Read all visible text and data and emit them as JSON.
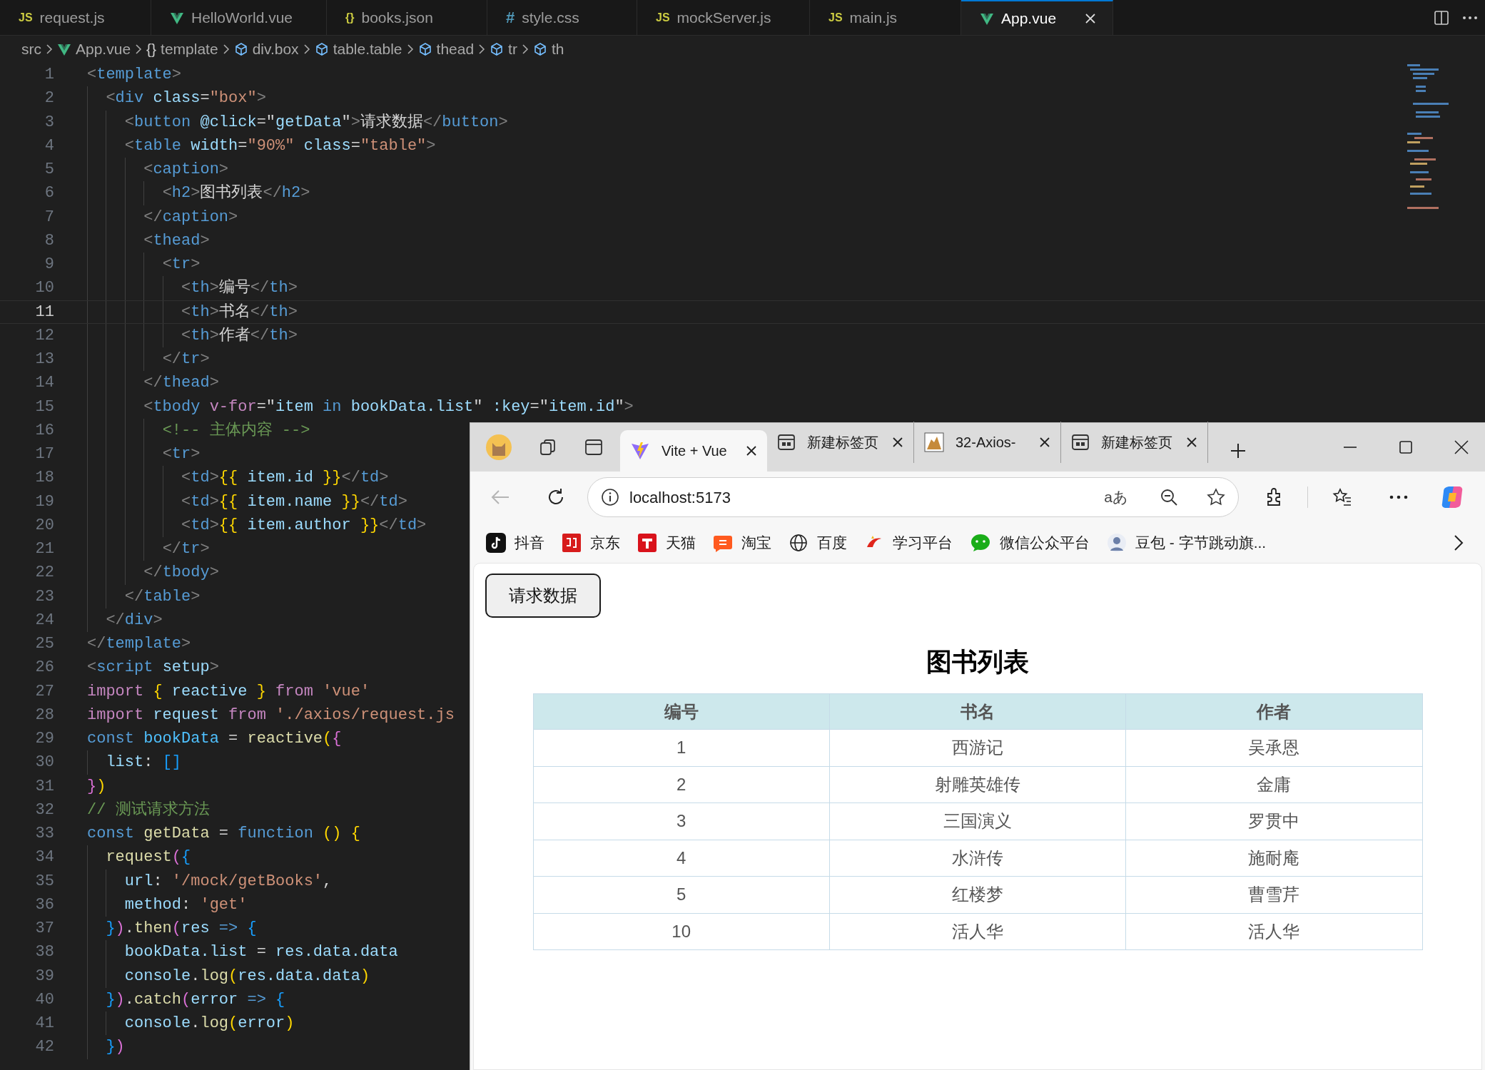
{
  "editor": {
    "tabs": [
      {
        "label": "request.js",
        "kind": "js",
        "badge": "JS",
        "selected": false
      },
      {
        "label": "HelloWorld.vue",
        "kind": "vue",
        "selected": false
      },
      {
        "label": "books.json",
        "kind": "json",
        "badge": "{}",
        "selected": false
      },
      {
        "label": "style.css",
        "kind": "css",
        "badge": "#",
        "selected": false
      },
      {
        "label": "mockServer.js",
        "kind": "js",
        "badge": "JS",
        "selected": false
      },
      {
        "label": "main.js",
        "kind": "js",
        "badge": "JS",
        "selected": false
      },
      {
        "label": "App.vue",
        "kind": "vue",
        "selected": true
      }
    ],
    "breadcrumbs": [
      {
        "label": "src",
        "kind": "folder"
      },
      {
        "label": "App.vue",
        "kind": "vue"
      },
      {
        "label": "template",
        "kind": "braces",
        "glyph": "{}"
      },
      {
        "label": "div.box",
        "kind": "element"
      },
      {
        "label": "table.table",
        "kind": "element"
      },
      {
        "label": "thead",
        "kind": "element"
      },
      {
        "label": "tr",
        "kind": "element"
      },
      {
        "label": "th",
        "kind": "element"
      }
    ],
    "lines": [
      {
        "number": "1",
        "current": false,
        "tokens": [
          {
            "text": "<",
            "kind": "punct"
          },
          {
            "text": "template",
            "kind": "tag"
          },
          {
            "text": ">",
            "kind": "punct"
          }
        ]
      },
      {
        "number": "2",
        "current": false,
        "tokens": [
          {
            "text": "  <",
            "kind": "punct"
          },
          {
            "text": "div ",
            "kind": "tag"
          },
          {
            "text": "class",
            "kind": "attr"
          },
          {
            "text": "=",
            "kind": "plain"
          },
          {
            "text": "\"box\"",
            "kind": "string"
          },
          {
            "text": ">",
            "kind": "punct"
          }
        ]
      },
      {
        "number": "3",
        "current": false,
        "tokens": [
          {
            "text": "    <",
            "kind": "punct"
          },
          {
            "text": "button ",
            "kind": "tag"
          },
          {
            "text": "@click",
            "kind": "attr"
          },
          {
            "text": "=\"",
            "kind": "plain"
          },
          {
            "text": "getData",
            "kind": "ident"
          },
          {
            "text": "\"",
            "kind": "plain"
          },
          {
            "text": ">",
            "kind": "punct"
          },
          {
            "text": "请求数据",
            "kind": "plain"
          },
          {
            "text": "</",
            "kind": "punct"
          },
          {
            "text": "button",
            "kind": "tag"
          },
          {
            "text": ">",
            "kind": "punct"
          }
        ]
      },
      {
        "number": "4",
        "current": false,
        "tokens": [
          {
            "text": "    <",
            "kind": "punct"
          },
          {
            "text": "table ",
            "kind": "tag"
          },
          {
            "text": "width",
            "kind": "attr"
          },
          {
            "text": "=",
            "kind": "plain"
          },
          {
            "text": "\"90%\" ",
            "kind": "string"
          },
          {
            "text": "class",
            "kind": "attr"
          },
          {
            "text": "=",
            "kind": "plain"
          },
          {
            "text": "\"table\"",
            "kind": "string"
          },
          {
            "text": ">",
            "kind": "punct"
          }
        ]
      },
      {
        "number": "5",
        "current": false,
        "tokens": [
          {
            "text": "      <",
            "kind": "punct"
          },
          {
            "text": "caption",
            "kind": "tag"
          },
          {
            "text": ">",
            "kind": "punct"
          }
        ]
      },
      {
        "number": "6",
        "current": false,
        "tokens": [
          {
            "text": "        <",
            "kind": "punct"
          },
          {
            "text": "h2",
            "kind": "tag"
          },
          {
            "text": ">",
            "kind": "punct"
          },
          {
            "text": "图书列表",
            "kind": "plain"
          },
          {
            "text": "</",
            "kind": "punct"
          },
          {
            "text": "h2",
            "kind": "tag"
          },
          {
            "text": ">",
            "kind": "punct"
          }
        ]
      },
      {
        "number": "7",
        "current": false,
        "tokens": [
          {
            "text": "      </",
            "kind": "punct"
          },
          {
            "text": "caption",
            "kind": "tag"
          },
          {
            "text": ">",
            "kind": "punct"
          }
        ]
      },
      {
        "number": "8",
        "current": false,
        "tokens": [
          {
            "text": "      <",
            "kind": "punct"
          },
          {
            "text": "thead",
            "kind": "tag"
          },
          {
            "text": ">",
            "kind": "punct"
          }
        ]
      },
      {
        "number": "9",
        "current": false,
        "tokens": [
          {
            "text": "        <",
            "kind": "punct"
          },
          {
            "text": "tr",
            "kind": "tag"
          },
          {
            "text": ">",
            "kind": "punct"
          }
        ]
      },
      {
        "number": "10",
        "current": false,
        "tokens": [
          {
            "text": "          <",
            "kind": "punct"
          },
          {
            "text": "th",
            "kind": "tag"
          },
          {
            "text": ">",
            "kind": "punct"
          },
          {
            "text": "编号",
            "kind": "plain"
          },
          {
            "text": "</",
            "kind": "punct"
          },
          {
            "text": "th",
            "kind": "tag"
          },
          {
            "text": ">",
            "kind": "punct"
          }
        ]
      },
      {
        "number": "11",
        "current": true,
        "tokens": [
          {
            "text": "          <",
            "kind": "punct"
          },
          {
            "text": "th",
            "kind": "tag"
          },
          {
            "text": ">",
            "kind": "punct"
          },
          {
            "text": "书名",
            "kind": "plain"
          },
          {
            "text": "</",
            "kind": "punct"
          },
          {
            "text": "th",
            "kind": "tag"
          },
          {
            "text": ">",
            "kind": "punct"
          }
        ]
      },
      {
        "number": "12",
        "current": false,
        "tokens": [
          {
            "text": "          <",
            "kind": "punct"
          },
          {
            "text": "th",
            "kind": "tag"
          },
          {
            "text": ">",
            "kind": "punct"
          },
          {
            "text": "作者",
            "kind": "plain"
          },
          {
            "text": "</",
            "kind": "punct"
          },
          {
            "text": "th",
            "kind": "tag"
          },
          {
            "text": ">",
            "kind": "punct"
          }
        ]
      },
      {
        "number": "13",
        "current": false,
        "tokens": [
          {
            "text": "        </",
            "kind": "punct"
          },
          {
            "text": "tr",
            "kind": "tag"
          },
          {
            "text": ">",
            "kind": "punct"
          }
        ]
      },
      {
        "number": "14",
        "current": false,
        "tokens": [
          {
            "text": "      </",
            "kind": "punct"
          },
          {
            "text": "thead",
            "kind": "tag"
          },
          {
            "text": ">",
            "kind": "punct"
          }
        ]
      },
      {
        "number": "15",
        "current": false,
        "tokens": [
          {
            "text": "      <",
            "kind": "punct"
          },
          {
            "text": "tbody ",
            "kind": "tag"
          },
          {
            "text": "v-for",
            "kind": "keyword"
          },
          {
            "text": "=\"",
            "kind": "plain"
          },
          {
            "text": "item",
            "kind": "ident"
          },
          {
            "text": " in ",
            "kind": "decl"
          },
          {
            "text": "bookData.list",
            "kind": "ident"
          },
          {
            "text": "\" ",
            "kind": "plain"
          },
          {
            "text": ":key",
            "kind": "attr"
          },
          {
            "text": "=\"",
            "kind": "plain"
          },
          {
            "text": "item.id",
            "kind": "ident"
          },
          {
            "text": "\"",
            "kind": "plain"
          },
          {
            "text": ">",
            "kind": "punct"
          }
        ]
      },
      {
        "number": "16",
        "current": false,
        "tokens": [
          {
            "text": "        <!-- 主体内容 -->",
            "kind": "comment"
          }
        ]
      },
      {
        "number": "17",
        "current": false,
        "tokens": [
          {
            "text": "        <",
            "kind": "punct"
          },
          {
            "text": "tr",
            "kind": "tag"
          },
          {
            "text": ">",
            "kind": "punct"
          }
        ]
      },
      {
        "number": "18",
        "current": false,
        "tokens": [
          {
            "text": "          <",
            "kind": "punct"
          },
          {
            "text": "td",
            "kind": "tag"
          },
          {
            "text": ">",
            "kind": "punct"
          },
          {
            "text": "{{",
            "kind": "bracket1"
          },
          {
            "text": " item.id ",
            "kind": "ident"
          },
          {
            "text": "}}",
            "kind": "bracket1"
          },
          {
            "text": "</",
            "kind": "punct"
          },
          {
            "text": "td",
            "kind": "tag"
          },
          {
            "text": ">",
            "kind": "punct"
          }
        ]
      },
      {
        "number": "19",
        "current": false,
        "tokens": [
          {
            "text": "          <",
            "kind": "punct"
          },
          {
            "text": "td",
            "kind": "tag"
          },
          {
            "text": ">",
            "kind": "punct"
          },
          {
            "text": "{{",
            "kind": "bracket1"
          },
          {
            "text": " item.name ",
            "kind": "ident"
          },
          {
            "text": "}}",
            "kind": "bracket1"
          },
          {
            "text": "</",
            "kind": "punct"
          },
          {
            "text": "td",
            "kind": "tag"
          },
          {
            "text": ">",
            "kind": "punct"
          }
        ]
      },
      {
        "number": "20",
        "current": false,
        "tokens": [
          {
            "text": "          <",
            "kind": "punct"
          },
          {
            "text": "td",
            "kind": "tag"
          },
          {
            "text": ">",
            "kind": "punct"
          },
          {
            "text": "{{",
            "kind": "bracket1"
          },
          {
            "text": " item.author ",
            "kind": "ident"
          },
          {
            "text": "}}",
            "kind": "bracket1"
          },
          {
            "text": "</",
            "kind": "punct"
          },
          {
            "text": "td",
            "kind": "tag"
          },
          {
            "text": ">",
            "kind": "punct"
          }
        ]
      },
      {
        "number": "21",
        "current": false,
        "tokens": [
          {
            "text": "        </",
            "kind": "punct"
          },
          {
            "text": "tr",
            "kind": "tag"
          },
          {
            "text": ">",
            "kind": "punct"
          }
        ]
      },
      {
        "number": "22",
        "current": false,
        "tokens": [
          {
            "text": "      </",
            "kind": "punct"
          },
          {
            "text": "tbody",
            "kind": "tag"
          },
          {
            "text": ">",
            "kind": "punct"
          }
        ]
      },
      {
        "number": "23",
        "current": false,
        "tokens": [
          {
            "text": "    </",
            "kind": "punct"
          },
          {
            "text": "table",
            "kind": "tag"
          },
          {
            "text": ">",
            "kind": "punct"
          }
        ]
      },
      {
        "number": "24",
        "current": false,
        "tokens": [
          {
            "text": "  </",
            "kind": "punct"
          },
          {
            "text": "div",
            "kind": "tag"
          },
          {
            "text": ">",
            "kind": "punct"
          }
        ]
      },
      {
        "number": "25",
        "current": false,
        "tokens": [
          {
            "text": "</",
            "kind": "punct"
          },
          {
            "text": "template",
            "kind": "tag"
          },
          {
            "text": ">",
            "kind": "punct"
          }
        ]
      },
      {
        "number": "26",
        "current": false,
        "tokens": [
          {
            "text": "<",
            "kind": "punct"
          },
          {
            "text": "script ",
            "kind": "tag"
          },
          {
            "text": "setup",
            "kind": "attr"
          },
          {
            "text": ">",
            "kind": "punct"
          }
        ]
      },
      {
        "number": "27",
        "current": false,
        "tokens": [
          {
            "text": "import ",
            "kind": "keyword"
          },
          {
            "text": "{",
            "kind": "bracket1"
          },
          {
            "text": " reactive ",
            "kind": "ident"
          },
          {
            "text": "} ",
            "kind": "bracket1"
          },
          {
            "text": "from ",
            "kind": "keyword"
          },
          {
            "text": "'vue'",
            "kind": "string"
          }
        ]
      },
      {
        "number": "28",
        "current": false,
        "tokens": [
          {
            "text": "import",
            "kind": "keyword"
          },
          {
            "text": " request ",
            "kind": "ident"
          },
          {
            "text": "from ",
            "kind": "keyword"
          },
          {
            "text": "'./axios/request.js",
            "kind": "string"
          }
        ]
      },
      {
        "number": "29",
        "current": false,
        "tokens": [
          {
            "text": "const ",
            "kind": "decl"
          },
          {
            "text": "bookData",
            "kind": "variable"
          },
          {
            "text": " = ",
            "kind": "plain"
          },
          {
            "text": "reactive",
            "kind": "function"
          },
          {
            "text": "(",
            "kind": "bracket1"
          },
          {
            "text": "{",
            "kind": "bracket2"
          }
        ]
      },
      {
        "number": "30",
        "current": false,
        "tokens": [
          {
            "text": "  list",
            "kind": "ident"
          },
          {
            "text": ": ",
            "kind": "plain"
          },
          {
            "text": "[]",
            "kind": "bracket3"
          }
        ]
      },
      {
        "number": "31",
        "current": false,
        "tokens": [
          {
            "text": "}",
            "kind": "bracket2"
          },
          {
            "text": ")",
            "kind": "bracket1"
          }
        ]
      },
      {
        "number": "32",
        "current": false,
        "tokens": [
          {
            "text": "// 测试请求方法",
            "kind": "comment"
          }
        ]
      },
      {
        "number": "33",
        "current": false,
        "tokens": [
          {
            "text": "const ",
            "kind": "decl"
          },
          {
            "text": "getData",
            "kind": "function"
          },
          {
            "text": " = ",
            "kind": "plain"
          },
          {
            "text": "function ",
            "kind": "decl"
          },
          {
            "text": "() ",
            "kind": "bracket1"
          },
          {
            "text": "{",
            "kind": "bracket1"
          }
        ]
      },
      {
        "number": "34",
        "current": false,
        "tokens": [
          {
            "text": "  request",
            "kind": "function"
          },
          {
            "text": "(",
            "kind": "bracket2"
          },
          {
            "text": "{",
            "kind": "bracket3"
          }
        ]
      },
      {
        "number": "35",
        "current": false,
        "tokens": [
          {
            "text": "    url",
            "kind": "ident"
          },
          {
            "text": ": ",
            "kind": "plain"
          },
          {
            "text": "'/mock/getBooks'",
            "kind": "string"
          },
          {
            "text": ",",
            "kind": "plain"
          }
        ]
      },
      {
        "number": "36",
        "current": false,
        "tokens": [
          {
            "text": "    method",
            "kind": "ident"
          },
          {
            "text": ": ",
            "kind": "plain"
          },
          {
            "text": "'get'",
            "kind": "string"
          }
        ]
      },
      {
        "number": "37",
        "current": false,
        "tokens": [
          {
            "text": "  }",
            "kind": "bracket3"
          },
          {
            "text": ")",
            "kind": "bracket2"
          },
          {
            "text": ".",
            "kind": "plain"
          },
          {
            "text": "then",
            "kind": "function"
          },
          {
            "text": "(",
            "kind": "bracket2"
          },
          {
            "text": "res",
            "kind": "ident"
          },
          {
            "text": " => ",
            "kind": "decl"
          },
          {
            "text": "{",
            "kind": "bracket3"
          }
        ]
      },
      {
        "number": "38",
        "current": false,
        "tokens": [
          {
            "text": "    bookData.list",
            "kind": "ident"
          },
          {
            "text": " = ",
            "kind": "plain"
          },
          {
            "text": "res.data.data",
            "kind": "ident"
          }
        ]
      },
      {
        "number": "39",
        "current": false,
        "tokens": [
          {
            "text": "    console",
            "kind": "ident"
          },
          {
            "text": ".",
            "kind": "plain"
          },
          {
            "text": "log",
            "kind": "function"
          },
          {
            "text": "(",
            "kind": "bracket1"
          },
          {
            "text": "res.data.data",
            "kind": "ident"
          },
          {
            "text": ")",
            "kind": "bracket1"
          }
        ]
      },
      {
        "number": "40",
        "current": false,
        "tokens": [
          {
            "text": "  }",
            "kind": "bracket3"
          },
          {
            "text": ")",
            "kind": "bracket2"
          },
          {
            "text": ".",
            "kind": "plain"
          },
          {
            "text": "catch",
            "kind": "function"
          },
          {
            "text": "(",
            "kind": "bracket2"
          },
          {
            "text": "error",
            "kind": "ident"
          },
          {
            "text": " => ",
            "kind": "decl"
          },
          {
            "text": "{",
            "kind": "bracket3"
          }
        ]
      },
      {
        "number": "41",
        "current": false,
        "tokens": [
          {
            "text": "    console",
            "kind": "ident"
          },
          {
            "text": ".",
            "kind": "plain"
          },
          {
            "text": "log",
            "kind": "function"
          },
          {
            "text": "(",
            "kind": "bracket1"
          },
          {
            "text": "error",
            "kind": "ident"
          },
          {
            "text": ")",
            "kind": "bracket1"
          }
        ]
      },
      {
        "number": "42",
        "current": false,
        "tokens": [
          {
            "text": "  }",
            "kind": "bracket3"
          },
          {
            "text": ")",
            "kind": "bracket2"
          }
        ]
      }
    ]
  },
  "browser": {
    "tabs": [
      {
        "label": "Vite + Vue",
        "kind": "vite",
        "selected": true
      },
      {
        "label": "新建标签页",
        "kind": "newtab",
        "selected": false
      },
      {
        "label": "32-Axios-",
        "kind": "cat",
        "selected": false
      },
      {
        "label": "新建标签页",
        "kind": "newtab",
        "selected": false
      }
    ],
    "back": {
      "disabled": true
    },
    "address": "localhost:5173",
    "read_aloud": "aあ",
    "bookmarks": [
      {
        "label": "抖音",
        "kind": "tiktok"
      },
      {
        "label": "京东",
        "kind": "jd"
      },
      {
        "label": "天猫",
        "kind": "tmall"
      },
      {
        "label": "淘宝",
        "kind": "taobao"
      },
      {
        "label": "百度",
        "kind": "globe"
      },
      {
        "label": "学习平台",
        "kind": "xuexi"
      },
      {
        "label": "微信公众平台",
        "kind": "wechat"
      },
      {
        "label": "豆包 - 字节跳动旗...",
        "kind": "doubao"
      }
    ],
    "page": {
      "button": "请求数据",
      "title": "图书列表",
      "table": {
        "columns": [
          "编号",
          "书名",
          "作者"
        ],
        "rows": [
          [
            "1",
            "西游记",
            "吴承恩"
          ],
          [
            "2",
            "射雕英雄传",
            "金庸"
          ],
          [
            "3",
            "三国演义",
            "罗贯中"
          ],
          [
            "4",
            "水浒传",
            "施耐庵"
          ],
          [
            "5",
            "红楼梦",
            "曹雪芹"
          ],
          [
            "10",
            "活人华",
            "活人华"
          ]
        ]
      }
    }
  }
}
